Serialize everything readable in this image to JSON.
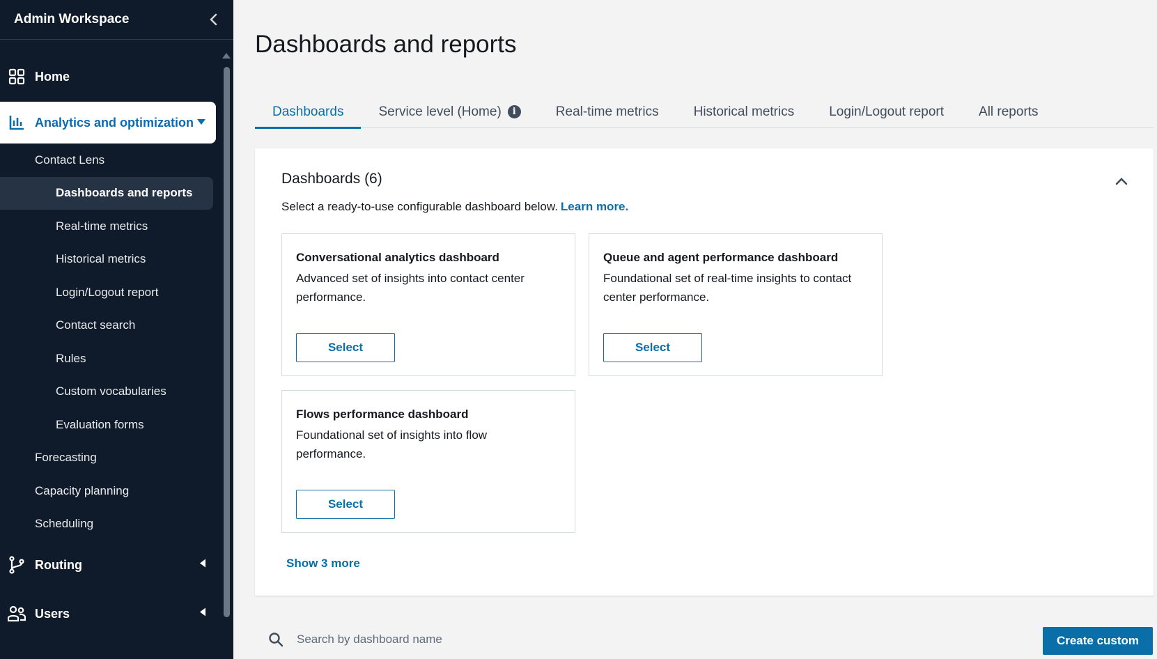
{
  "sidebar": {
    "title": "Admin Workspace",
    "nav": {
      "home": "Home",
      "analytics": "Analytics and optimization",
      "routing": "Routing",
      "users": "Users"
    },
    "analytics_items": {
      "contact_lens": "Contact Lens",
      "dashboards": "Dashboards and reports",
      "realtime": "Real-time metrics",
      "historical": "Historical metrics",
      "login_logout": "Login/Logout report",
      "contact_search": "Contact search",
      "rules": "Rules",
      "custom_vocab": "Custom vocabularies",
      "evaluation_forms": "Evaluation forms",
      "forecasting": "Forecasting",
      "capacity": "Capacity planning",
      "scheduling": "Scheduling"
    }
  },
  "main": {
    "title": "Dashboards and reports",
    "tabs": [
      {
        "label": "Dashboards"
      },
      {
        "label": "Service level (Home)"
      },
      {
        "label": "Real-time metrics"
      },
      {
        "label": "Historical metrics"
      },
      {
        "label": "Login/Logout report"
      },
      {
        "label": "All reports"
      }
    ],
    "panel": {
      "title": "Dashboards (6)",
      "description": "Select a ready-to-use configurable dashboard below.",
      "learn_more": "Learn more.",
      "cards": [
        {
          "title": "Conversational analytics dashboard",
          "description": "Advanced set of insights into contact center performance.",
          "button": "Select"
        },
        {
          "title": "Queue and agent performance dashboard",
          "description": "Foundational set of real-time insights to contact center performance.",
          "button": "Select"
        },
        {
          "title": "Flows performance dashboard",
          "description": "Foundational set of insights into flow performance.",
          "button": "Select"
        }
      ],
      "show_more": "Show 3 more"
    },
    "search": {
      "placeholder": "Search by dashboard name"
    },
    "create_button": "Create custom"
  },
  "colors": {
    "sidebar_bg": "#0f1b2a",
    "accent": "#0a6fa8",
    "page_bg": "#f3f3f3"
  },
  "icons": {
    "collapse": "chevron-left-icon",
    "home": "grid-icon",
    "analytics": "bar-chart-icon",
    "routing": "routing-icon",
    "users": "users-icon",
    "info": "info-icon",
    "panel_collapse": "chevron-up-icon",
    "search": "search-icon"
  }
}
